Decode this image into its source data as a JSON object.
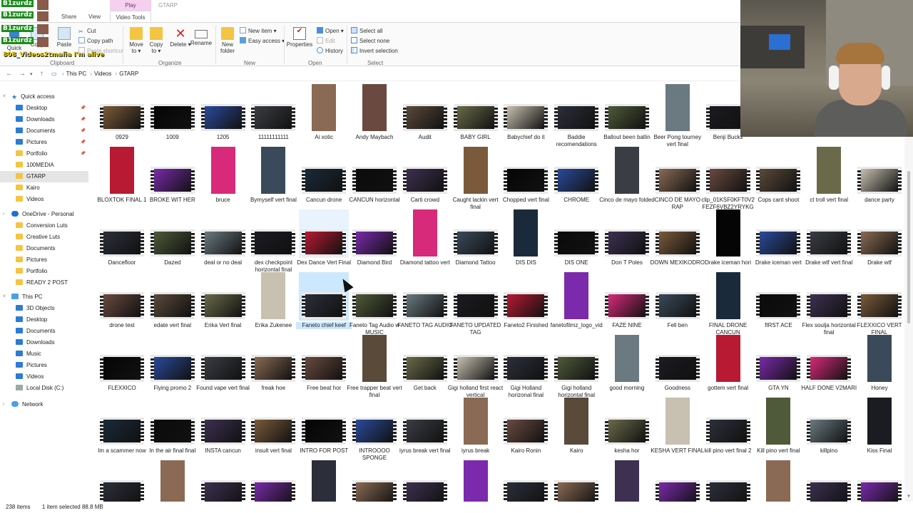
{
  "ribbon": {
    "contextual_tab": "Play",
    "window_title": "GTARP",
    "tabs": [
      "Share",
      "View",
      "Video Tools"
    ],
    "clipboard": {
      "pin_label": "Pin to Quick",
      "copy": "Copy",
      "paste": "Paste",
      "cut": "Cut",
      "copy_path": "Copy path",
      "paste_shortcut": "Paste shortcut",
      "group": "Clipboard"
    },
    "organize": {
      "move_to": "Move",
      "move_to2": "to",
      "copy_to": "Copy",
      "copy_to2": "to",
      "delete": "Delete",
      "rename": "Rename",
      "group": "Organize"
    },
    "new": {
      "new_folder": "New",
      "new_folder2": "folder",
      "new_item": "New item",
      "easy_access": "Easy access",
      "group": "New"
    },
    "open": {
      "properties": "Properties",
      "open": "Open",
      "edit": "Edit",
      "history": "History",
      "group": "Open"
    },
    "select": {
      "select_all": "Select all",
      "select_none": "Select none",
      "invert": "Invert selection",
      "group": "Select"
    }
  },
  "overlay": {
    "tag1": "B1zurdz",
    "tag2": "B1zurdz",
    "tag3": "B1zurdz",
    "tag4": "B1zurdz",
    "text": "808_Videos2tmafia  I'm alive"
  },
  "address": {
    "crumbs": [
      "This PC",
      "Videos",
      "GTARP"
    ]
  },
  "sidebar": {
    "quick_access": "Quick access",
    "qa_items": [
      "Desktop",
      "Downloads",
      "Documents",
      "Pictures",
      "Portfolio",
      "100MEDIA",
      "GTARP",
      "Kairo",
      "Videos"
    ],
    "onedrive": "OneDrive - Personal",
    "od_items": [
      "Conversion Luts",
      "Creative Luts",
      "Documents",
      "Pictures",
      "Portfolio",
      "READY 2 POST"
    ],
    "this_pc": "This PC",
    "pc_items": [
      "3D Objects",
      "Desktop",
      "Documents",
      "Downloads",
      "Music",
      "Pictures",
      "Videos",
      "Local Disk (C:)"
    ],
    "network": "Network"
  },
  "files": [
    "0929",
    "1009",
    "1205",
    "11111111111",
    "Ai xotic",
    "Andy Maybach",
    "Audit",
    "BABY GIRL",
    "Babychief do it",
    "Baddie recomendations",
    "Ballout been ballin",
    "Beer Pong tourney vert final",
    "Benji Bucks",
    "BLOXTOK FINAL 1",
    "BROKE WIT HER",
    "bruce",
    "Bymyself vert final",
    "Cancun drone",
    "CANCUN horizontal",
    "Carti crowd",
    "Caught lackin vert final",
    "Chopped vert final",
    "CHROME",
    "Cinco de mayo folded",
    "CINCO DE MAYO RAP",
    "clip_01KSF0KFT0V2FEZF6VBZ2YRYKG",
    "Cops cant shoot",
    "ct troll vert final",
    "dance party",
    "Dancefloor",
    "Dazed",
    "deal or no deal",
    "dex checkpoint horizontal final",
    "Dex Dance Vert Final",
    "Diamond Bird",
    "Diamond tattoo vert",
    "Diamond Tattoo",
    "DIS DIS",
    "DIS ONE",
    "Don T Poles",
    "DOWN MEXIKODRO",
    "Drake iceman hori",
    "Drake iceman vert",
    "Drake wtf vert final",
    "Drake wtf",
    "drone test",
    "edate vert final",
    "Erika Vert final",
    "Erika Zukenee",
    "Faneto chief keef",
    "Faneto Tag Audio w MUSIC",
    "FANETO TAG AUDIO",
    "FANETO UPDATED TAG",
    "Faneto2 Finished",
    "fanetofilmz_logo_vid",
    "FAZE NINE",
    "Fell ben",
    "FINAL DRONE CANCUN",
    "fIRST ACE",
    "Flex soulja horizontal final",
    "FLEXXICO VERT FINAL",
    "FLEXXICO",
    "Flying promo 2",
    "Found vape vert final",
    "freak hoe",
    "Free beat hor",
    "Free trapper beat vert final",
    "Get back",
    "Gigi holland first react vertical",
    "Gigi Holland horizonal final",
    "Gigi holland horizontal final",
    "good morning",
    "Goodness",
    "gottem vert final",
    "GTA YN",
    "HALF DONE V2MARI",
    "Honey",
    "Im a scammer now",
    "In the air final final",
    "INSTA cancun",
    "insult vert final",
    "INTRO FOR POST",
    "INTROOOO SPONGE",
    "iyrus break vert final",
    "iyrus break",
    "Kairo Ronin",
    "Kairo",
    "kesha hor",
    "KESHA VERT FINAL",
    "kill pino vert final 2",
    "Kill pino vert final",
    "killpino",
    "Kiss Final"
  ],
  "status": {
    "count": "238 items",
    "selected": "1 item selected  88.8 MB"
  }
}
